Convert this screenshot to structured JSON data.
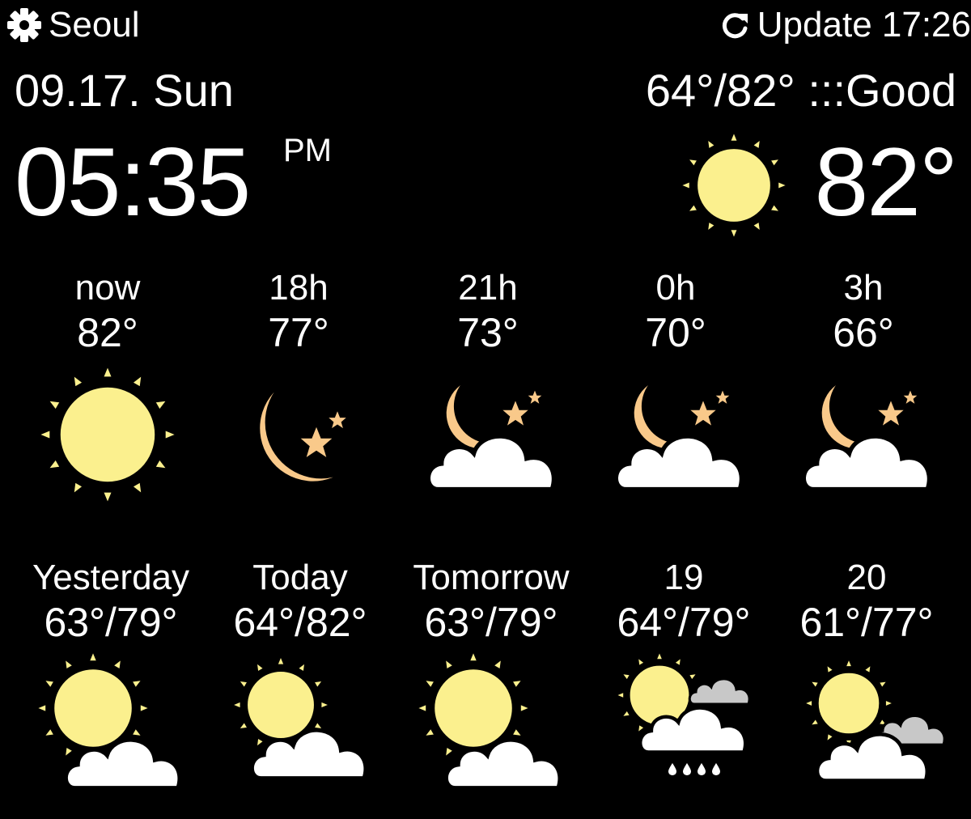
{
  "header": {
    "city": "Seoul",
    "update_label": "Update 17:26",
    "settings_icon": "gear-icon",
    "refresh_icon": "refresh-icon"
  },
  "today": {
    "date": "09.17. Sun",
    "range_quality": "64°/82° :::Good",
    "time": "05:35",
    "ampm": "PM",
    "current_temp": "82°",
    "current_icon": "sun-icon"
  },
  "hourly": [
    {
      "label": "now",
      "temp": "82°",
      "icon": "sun-icon"
    },
    {
      "label": "18h",
      "temp": "77°",
      "icon": "moon-stars-icon"
    },
    {
      "label": "21h",
      "temp": "73°",
      "icon": "moon-cloud-icon"
    },
    {
      "label": "0h",
      "temp": "70°",
      "icon": "moon-cloud-icon"
    },
    {
      "label": "3h",
      "temp": "66°",
      "icon": "moon-cloud-icon"
    }
  ],
  "daily": [
    {
      "label": "Yesterday",
      "temp": "63°/79°",
      "icon": "sun-cloud-icon"
    },
    {
      "label": "Today",
      "temp": "64°/82°",
      "icon": "sun-cloud-icon"
    },
    {
      "label": "Tomorrow",
      "temp": "63°/79°",
      "icon": "sun-cloud-icon"
    },
    {
      "label": "19",
      "temp": "64°/79°",
      "icon": "sun-rain-cloud-icon"
    },
    {
      "label": "20",
      "temp": "61°/77°",
      "icon": "sun-clouds-icon"
    }
  ],
  "colors": {
    "background": "#000000",
    "text": "#ffffff",
    "sun": "#fbf08e",
    "moon": "#f9c98a",
    "cloud": "#ffffff",
    "gray_cloud": "#c8c8c8"
  }
}
